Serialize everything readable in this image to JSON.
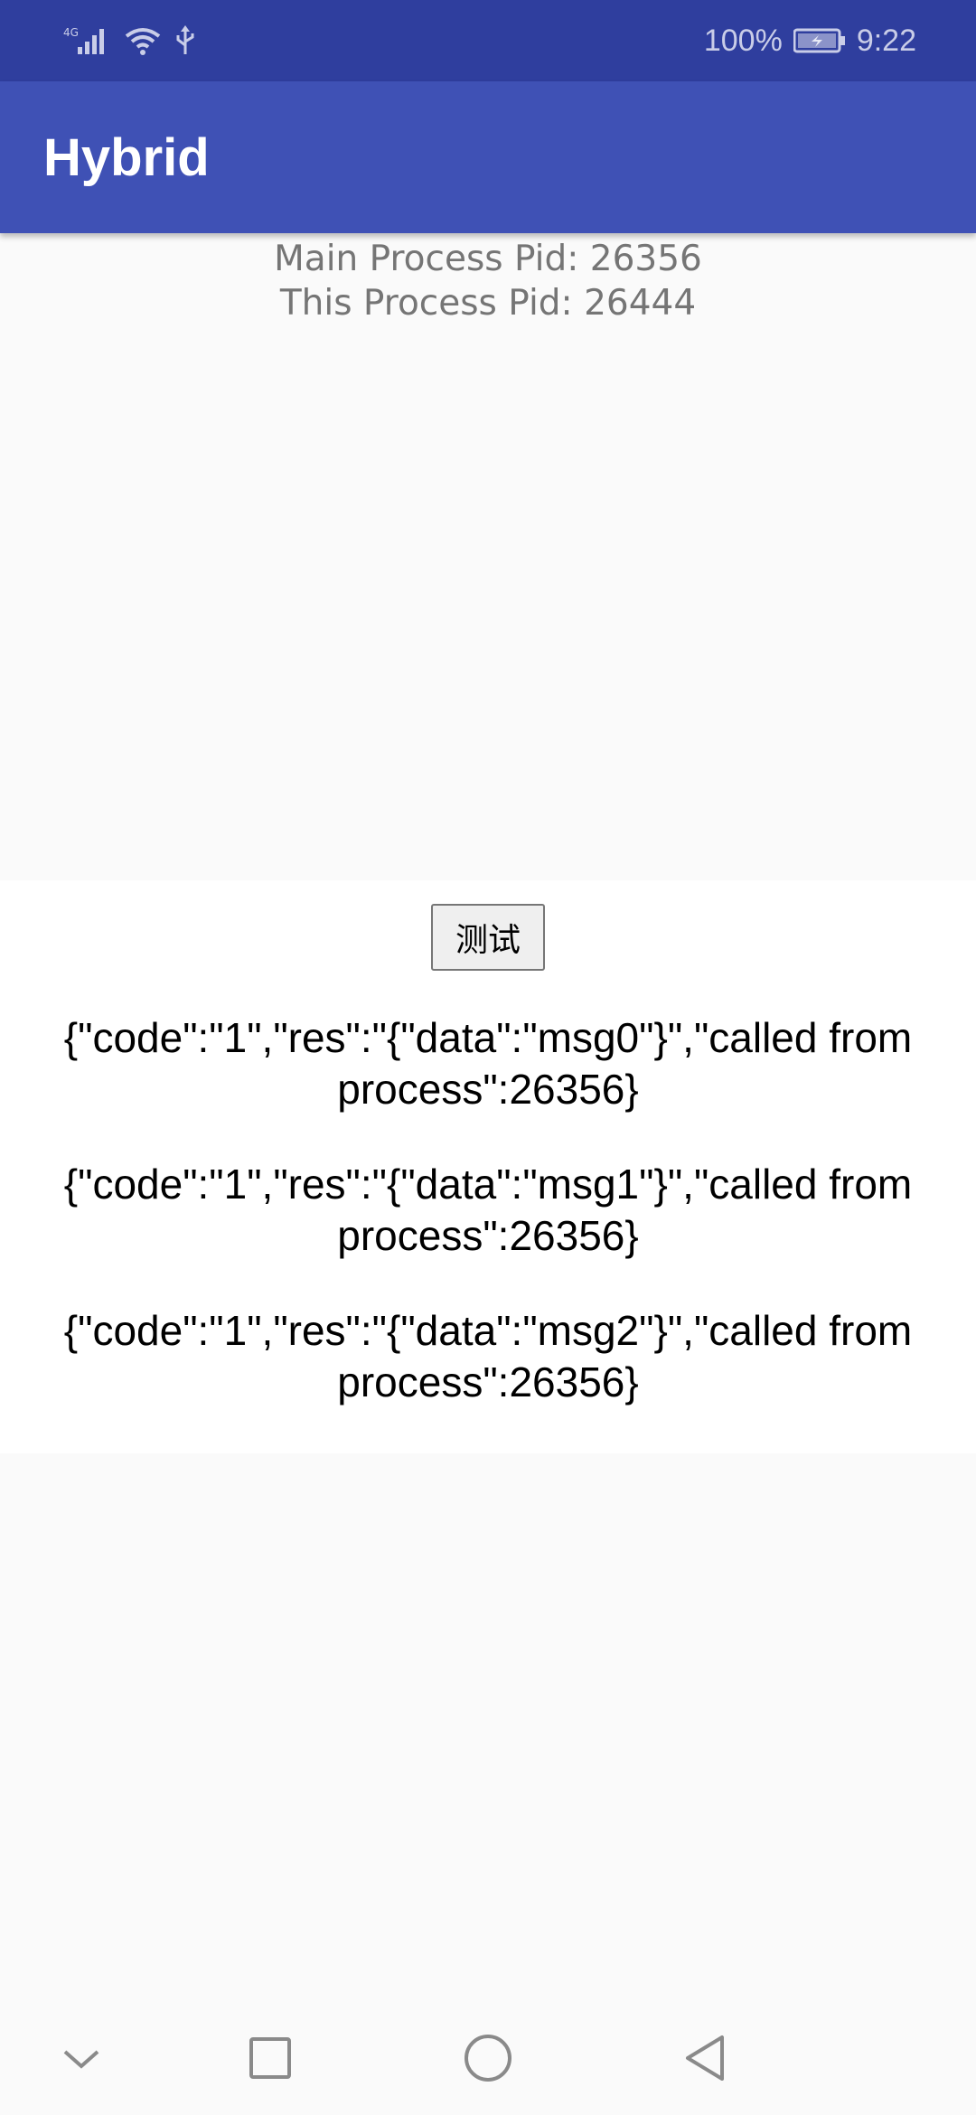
{
  "status_bar": {
    "network": "4G",
    "battery_percent": "100%",
    "time": "9:22",
    "icons": [
      "signal-icon",
      "wifi-icon",
      "usb-icon",
      "battery-charging-icon"
    ]
  },
  "app_bar": {
    "title": "Hybrid"
  },
  "process_info": {
    "main_pid": "Main Process Pid: 26356",
    "this_pid": "This Process Pid: 26444"
  },
  "web_content": {
    "test_button_label": "测试",
    "results": [
      "{\"code\":\"1\",\"res\":\"{\"data\":\"msg0\"}\",\"called from process\":26356}",
      "{\"code\":\"1\",\"res\":\"{\"data\":\"msg1\"}\",\"called from process\":26356}",
      "{\"code\":\"1\",\"res\":\"{\"data\":\"msg2\"}\",\"called from process\":26356}"
    ]
  },
  "nav_bar": {
    "icons": [
      "hide-keyboard-icon",
      "recents-icon",
      "home-icon",
      "back-icon"
    ]
  },
  "colors": {
    "status_bar": "#2f3e9e",
    "app_bar": "#3f51b5",
    "page_background": "#fafafa",
    "web_background": "#ffffff"
  }
}
